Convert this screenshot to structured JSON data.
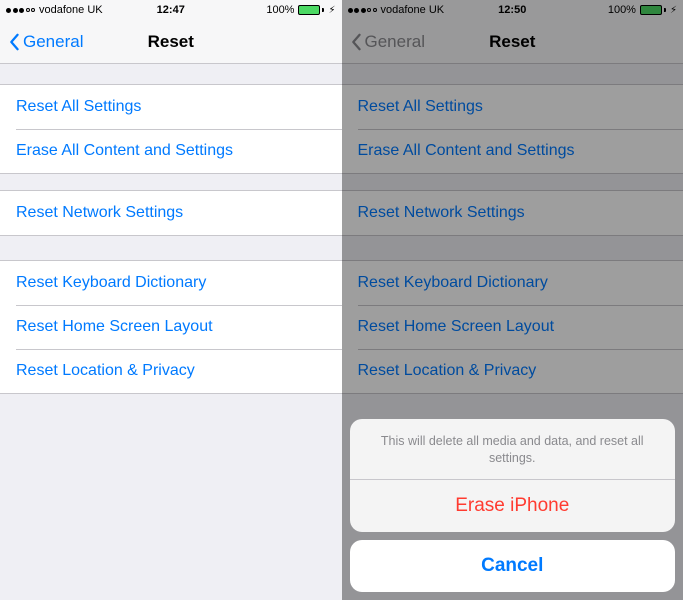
{
  "left": {
    "status": {
      "carrier": "vodafone UK",
      "time": "12:47",
      "battery_pct": "100%"
    },
    "nav": {
      "back": "General",
      "title": "Reset"
    },
    "groups": [
      [
        "Reset All Settings",
        "Erase All Content and Settings"
      ],
      [
        "Reset Network Settings"
      ],
      [
        "Reset Keyboard Dictionary",
        "Reset Home Screen Layout",
        "Reset Location & Privacy"
      ]
    ]
  },
  "right": {
    "status": {
      "carrier": "vodafone UK",
      "time": "12:50",
      "battery_pct": "100%"
    },
    "nav": {
      "back": "General",
      "title": "Reset"
    },
    "groups": [
      [
        "Reset All Settings",
        "Erase All Content and Settings"
      ],
      [
        "Reset Network Settings"
      ],
      [
        "Reset Keyboard Dictionary",
        "Reset Home Screen Layout",
        "Reset Location & Privacy"
      ]
    ],
    "sheet": {
      "message": "This will delete all media and data, and reset all settings.",
      "destructive": "Erase iPhone",
      "cancel": "Cancel"
    }
  }
}
